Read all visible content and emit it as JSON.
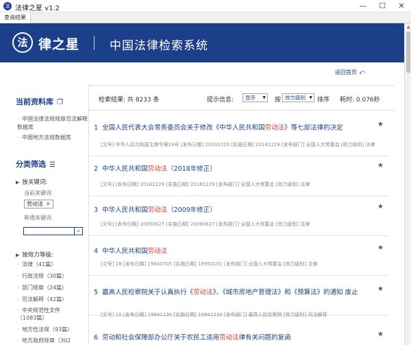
{
  "window": {
    "title": "法律之星 v1.2",
    "app_icon_glyph": "法",
    "min_glyph": "—",
    "max_glyph": "☐",
    "close_glyph": "✕",
    "tab_label": "查询结果"
  },
  "header": {
    "logo_glyph": "法",
    "brand": "律之星",
    "title": "中国法律检索系统",
    "bg_color": "#1c3f8a"
  },
  "back_home": {
    "label": "返回首页",
    "icon": "back-arrow-icon"
  },
  "sidebar": {
    "current_db_title": "当前资料库",
    "current_db_icon": "copy-icon",
    "databases": [
      "中国法律法规规章司法解释数据库",
      "中国地方法规数据库"
    ],
    "filter_title": "分类筛选",
    "filter_icon": "filter-list-icon",
    "by_keyword_label": "按关键词:",
    "current_keyword_label": "当前关键词",
    "keyword_tag": "劳动法",
    "keyword_tag_remove": "✕",
    "new_keyword_label": "新增关键词",
    "new_keyword_value": "",
    "search_icon": "search-icon",
    "by_effect_label": "按效力等级:",
    "effect_levels": [
      "法律（41篇）",
      "行政法规（30篇）",
      "部门规章（24篇）",
      "司法解释（42篇）",
      "中央规范性文件（1083篇）",
      "地方性法规（93篇）",
      "地方政府规章（302"
    ]
  },
  "results": {
    "count_label": "检索结果: 共 8233 条",
    "hint_label": "提示信息:",
    "show_select": "显示",
    "by_label": "按",
    "order_select": "效力级别",
    "sort_label": "排序",
    "time_label": "耗时: 0.076秒",
    "items": [
      {
        "index": "1",
        "title_pre": "全国人民代表大会常务委员会关于修改《中华人民共和国",
        "title_hl": "劳动法",
        "title_post": "》等七部法律的决定",
        "meta": "[文号] 中华人民共和国主席令第24号  [发布日期] 20181229  [实施日期] 20181229  [发布部门] 全国人大常委会  [效力级别] 法律"
      },
      {
        "index": "2",
        "title_pre": "中华人民共和国",
        "title_hl": "劳动法",
        "title_post": "（2018年修正）",
        "meta": "[文号]  [发布日期] 20181229  [实施日期] 20181229  [发布部门] 全国人大常委会  [效力级别] 法律"
      },
      {
        "index": "3",
        "title_pre": "中华人民共和国",
        "title_hl": "劳动法",
        "title_post": "（2009年修正）",
        "meta": "[文号]  [发布日期] 20090827  [实施日期] 20090827  [发布部门] 全国人大常委会  [效力级别] 法律"
      },
      {
        "index": "4",
        "title_pre": "中华人民共和国",
        "title_hl": "劳动法",
        "title_post": "",
        "meta": "[文号] 28  [发布日期] 19940705  [实施日期] 19950101  [发布部门] 全国人大常委会  [效力级别] 法律"
      },
      {
        "index": "5",
        "title_pre": "最高人民检察院关于认真执行《",
        "title_hl": "劳动法",
        "title_post": "》、《城市房地产管理法》和《预算法》的通知  废止",
        "meta": "[文号] 10  [发布日期] 19941230  [实施日期] 19941230  [发布部门] 最高人民检察院  [效力级别] 司法解释"
      },
      {
        "index": "6",
        "title_pre": "劳动和社会保障部办公厅关于农民工适用",
        "title_hl": "劳动法",
        "title_post": "律有关问题的复函",
        "meta": ""
      }
    ],
    "star_icon": "star-icon",
    "star_glyph": "★",
    "highlight_color": "#d23c2a"
  }
}
